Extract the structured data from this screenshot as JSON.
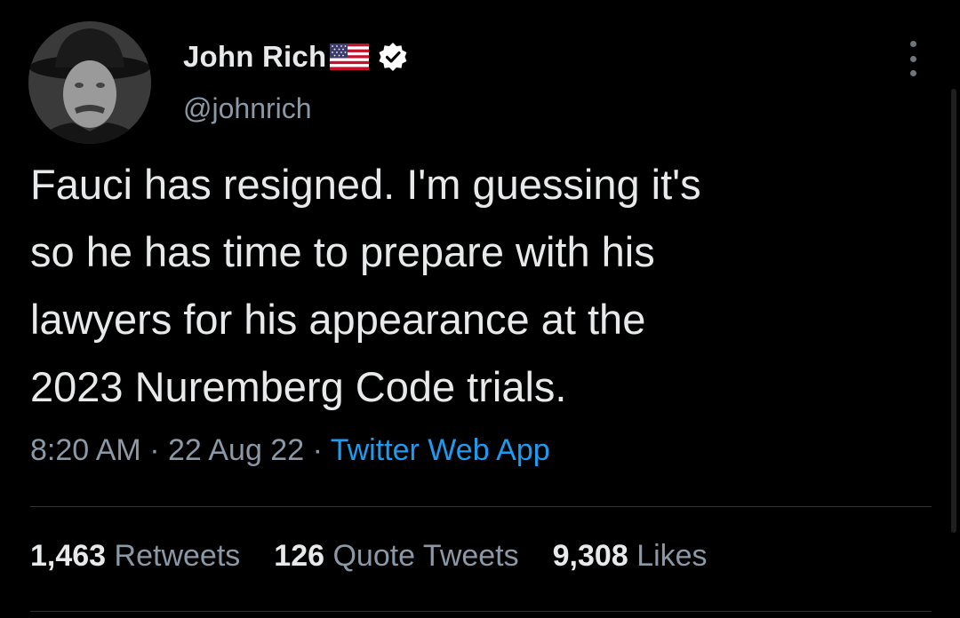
{
  "author": {
    "display_name": "John Rich",
    "handle": "@johnrich",
    "flag_icon": "us-flag-icon",
    "verified_icon": "verified-badge-icon",
    "verified_color": "#ffffff"
  },
  "tweet": {
    "text": "Fauci has resigned. I'm guessing it's\nso he has time to prepare with his\nlawyers for his appearance at the\n2023 Nuremberg Code trials.",
    "time": "8:20 AM",
    "separator": " · ",
    "date": "22 Aug 22",
    "source": "Twitter Web App"
  },
  "stats": {
    "retweets_count": "1,463",
    "retweets_label": "Retweets",
    "quotes_count": "126",
    "quotes_label": "Quote Tweets",
    "likes_count": "9,308",
    "likes_label": "Likes"
  },
  "colors": {
    "background": "#000000",
    "primary_text": "#e7e9ea",
    "secondary_text": "#8b98a5",
    "link": "#1d9bf0"
  }
}
